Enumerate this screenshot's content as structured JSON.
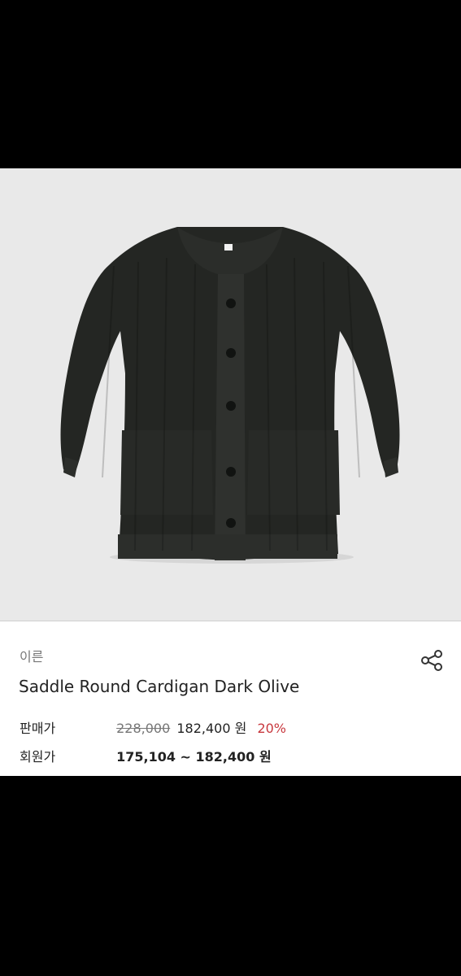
{
  "product": {
    "image_alt": "dark olive saddle round cardigan",
    "brand": "이른",
    "name": "Saddle Round Cardigan Dark Olive"
  },
  "pricing": {
    "sale_label": "판매가",
    "original_price": "228,000",
    "sale_price": "182,400 원",
    "discount": "20%",
    "member_label": "회원가",
    "member_price": "175,104 ~ 182,400 원"
  },
  "icons": {
    "share": "share-icon"
  },
  "colors": {
    "discount": "#c8383e",
    "image_background": "#e9e9e9",
    "cardigan": "#232523"
  }
}
